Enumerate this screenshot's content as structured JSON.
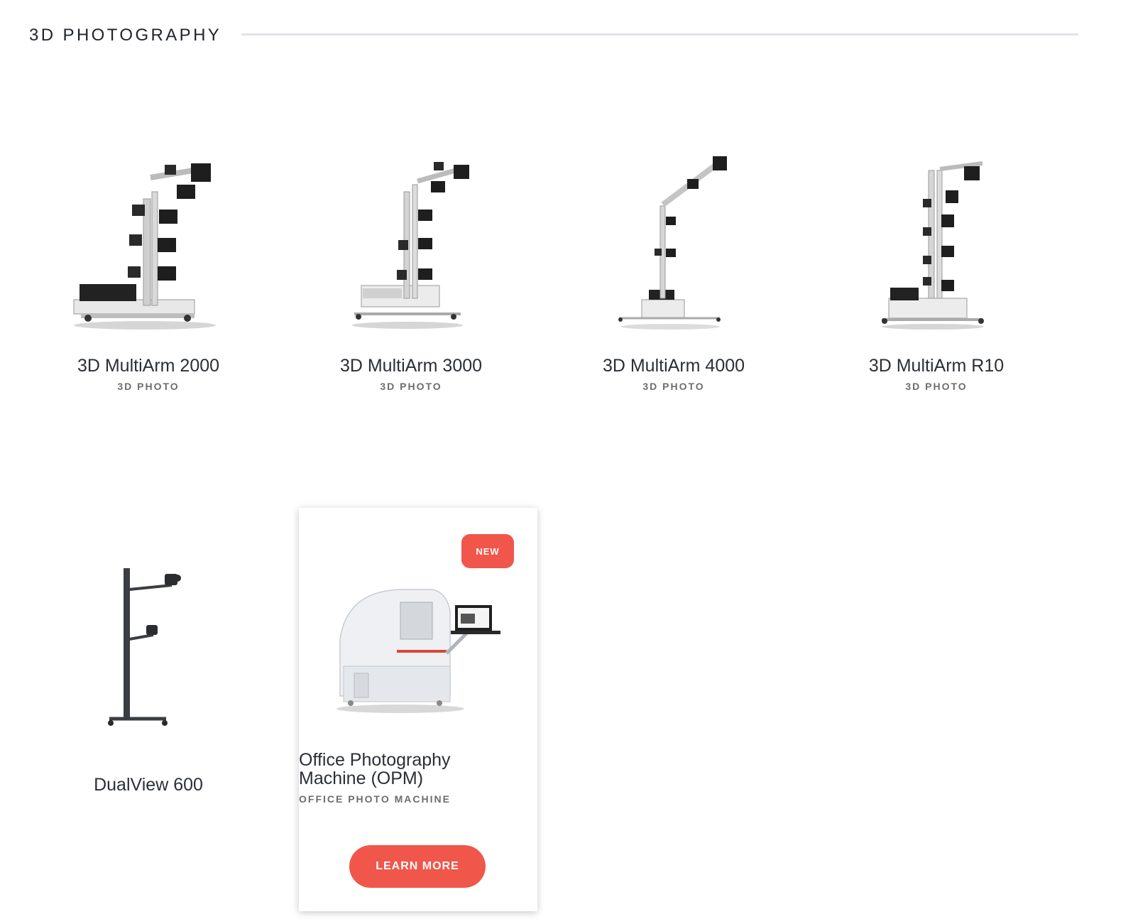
{
  "section": {
    "title": "3D PHOTOGRAPHY"
  },
  "products": [
    {
      "name": "3D MultiArm 2000",
      "category": "3D PHOTO",
      "image": "multiarm-2000-image"
    },
    {
      "name": "3D MultiArm 3000",
      "category": "3D PHOTO",
      "image": "multiarm-3000-image"
    },
    {
      "name": "3D MultiArm 4000",
      "category": "3D PHOTO",
      "image": "multiarm-4000-image"
    },
    {
      "name": "3D MultiArm R10",
      "category": "3D PHOTO",
      "image": "multiarm-r10-image"
    },
    {
      "name": "DualView 600",
      "image": "dualview-600-image"
    }
  ],
  "featured": {
    "badge": "NEW",
    "name_line1": "Office Photography",
    "name_line2": "Machine (OPM)",
    "category": "OFFICE PHOTO MACHINE",
    "button_label": "LEARN MORE",
    "image": "opm-image",
    "accent_color": "#f1564a"
  }
}
